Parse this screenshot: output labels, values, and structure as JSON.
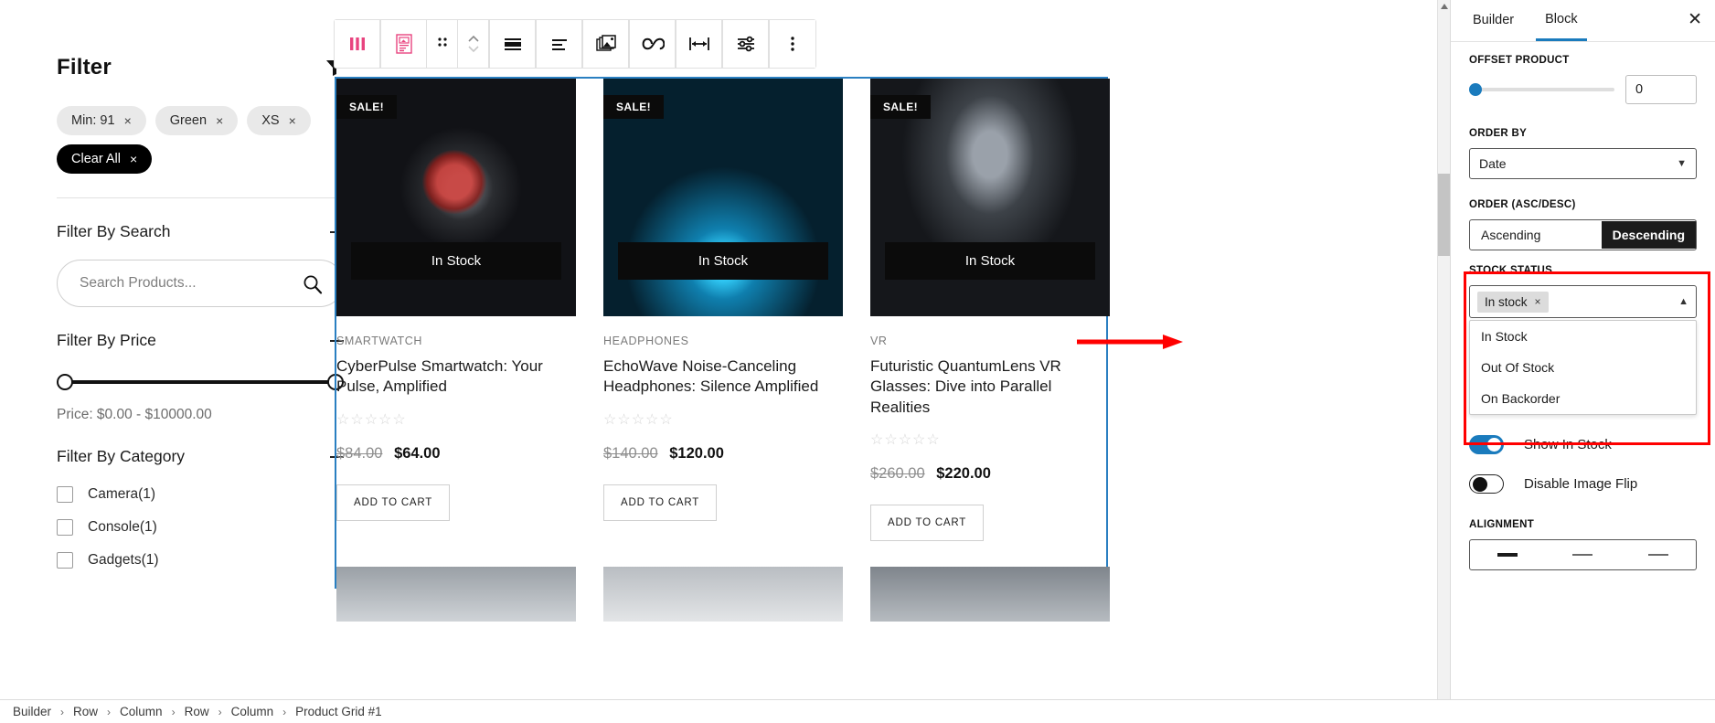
{
  "sidebar": {
    "title": "Filter",
    "funnel_icon": "funnel-icon",
    "chips": [
      {
        "label": "Min: 91",
        "close": "×"
      },
      {
        "label": "Green",
        "close": "×"
      },
      {
        "label": "XS",
        "close": "×"
      }
    ],
    "clear_all": {
      "label": "Clear All",
      "close": "×"
    },
    "search_section": {
      "title": "Filter By Search",
      "collapse": "−",
      "placeholder": "Search Products...",
      "value": ""
    },
    "price_section": {
      "title": "Filter By Price",
      "collapse": "−",
      "range_label": "Price: $0.00 - $10000.00",
      "min": "0.00",
      "max": "10000.00"
    },
    "category_section": {
      "title": "Filter By Category",
      "collapse": "−",
      "items": [
        {
          "label": "Camera(1)",
          "checked": false
        },
        {
          "label": "Console(1)",
          "checked": false
        },
        {
          "label": "Gadgets(1)",
          "checked": false
        }
      ]
    }
  },
  "toolbar": {
    "items": [
      {
        "name": "columns-icon",
        "title": "Columns"
      },
      {
        "name": "block-preview-icon",
        "title": "Block"
      },
      {
        "name": "drag-handle-icon",
        "title": "Drag"
      },
      {
        "name": "move-updown-icon",
        "title": "Move"
      },
      {
        "name": "align-full-icon",
        "title": "Align Full"
      },
      {
        "name": "align-left-icon",
        "title": "Align Left"
      },
      {
        "name": "gallery-icon",
        "title": "Gallery"
      },
      {
        "name": "link-icon",
        "title": "Link"
      },
      {
        "name": "width-icon",
        "title": "Width"
      },
      {
        "name": "settings-sliders-icon",
        "title": "Settings"
      },
      {
        "name": "more-options-icon",
        "title": "More"
      }
    ]
  },
  "products": [
    {
      "badge": "SALE!",
      "stock": "In Stock",
      "category": "SMARTWATCH",
      "title": "CyberPulse Smartwatch: Your Pulse, Amplified",
      "stars": "☆☆☆☆☆",
      "old_price": "$84.00",
      "new_price": "$64.00",
      "add_to_cart": "ADD TO CART",
      "image": "img-watch"
    },
    {
      "badge": "SALE!",
      "stock": "In Stock",
      "category": "HEADPHONES",
      "title": "EchoWave Noise-Canceling Headphones: Silence Amplified",
      "stars": "☆☆☆☆☆",
      "old_price": "$140.00",
      "new_price": "$120.00",
      "add_to_cart": "ADD TO CART",
      "image": "img-head"
    },
    {
      "badge": "SALE!",
      "stock": "In Stock",
      "category": "VR",
      "title": "Futuristic QuantumLens VR Glasses: Dive into Parallel Realities",
      "stars": "☆☆☆☆☆",
      "old_price": "$260.00",
      "new_price": "$220.00",
      "add_to_cart": "ADD TO CART",
      "image": "img-vr"
    }
  ],
  "panel": {
    "tabs": [
      {
        "label": "Builder",
        "active": false
      },
      {
        "label": "Block",
        "active": true
      }
    ],
    "close_icon": "close-icon",
    "offset_product": {
      "label": "OFFSET PRODUCT",
      "value": "0",
      "slider_percent": 0
    },
    "order_by": {
      "label": "ORDER BY",
      "value": "Date",
      "caret": "⌄"
    },
    "order_dir": {
      "label": "ORDER (ASC/DESC)",
      "options": [
        "Ascending",
        "Descending"
      ],
      "selected": "Descending"
    },
    "stock_status": {
      "label": "STOCK STATUS",
      "selected_tags": [
        {
          "label": "In stock",
          "close": "×"
        }
      ],
      "caret": "˄",
      "options": [
        "In Stock",
        "Out Of Stock",
        "On Backorder"
      ],
      "highlight_color": "#ff0000"
    },
    "show_in_stock": {
      "label": "Show In Stock",
      "enabled": true
    },
    "disable_image_flip": {
      "label": "Disable Image Flip",
      "enabled": false
    },
    "alignment": {
      "label": "ALIGNMENT",
      "options": [
        "left",
        "center",
        "right"
      ],
      "selected": "left"
    }
  },
  "breadcrumb": {
    "items": [
      "Builder",
      "Row",
      "Column",
      "Row",
      "Column",
      "Product Grid #1"
    ],
    "separator": "›"
  }
}
